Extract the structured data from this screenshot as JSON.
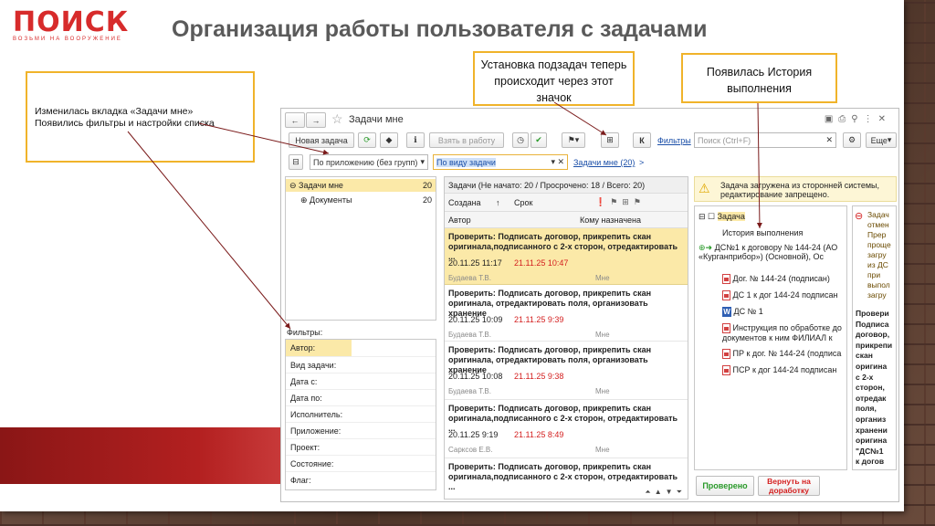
{
  "logo": {
    "text": "ПОИСК",
    "tagline": "ВОЗЬМИ НА ВООРУЖЕНИЕ"
  },
  "slide_title": "Организация работы пользователя с задачами",
  "callouts": {
    "c1_line1": "Изменилась вкладка «Задачи мне»",
    "c1_line2": "Появились фильтры и настройки списка",
    "c2": "Установка подзадач теперь происходит через этот значок",
    "c3": "Появилась История выполнения"
  },
  "window": {
    "title": "Задачи мне",
    "new_task": "Новая задача",
    "take_to_work": "Взять в работу",
    "k_label": "К",
    "filters_link": "Фильтры",
    "search_placeholder": "Поиск (Ctrl+F)",
    "more": "Еще",
    "grouping_value": "По приложению (без групп)",
    "task_type_value": "По виду задачи",
    "tasks_to_me_link": "Задачи мне (20)",
    "tasks_to_me_arrow": ">"
  },
  "tree": {
    "items": [
      {
        "label": "Задачи мне",
        "count": "20"
      },
      {
        "label": "Документы",
        "count": "20"
      }
    ]
  },
  "filters": {
    "title": "Фильтры:",
    "rows": [
      "Автор:",
      "Вид задачи:",
      "Дата с:",
      "Дата по:",
      "Исполнитель:",
      "Приложение:",
      "Проект:",
      "Состояние:",
      "Флаг:"
    ]
  },
  "list": {
    "header": "Задачи (Не начато: 20 / Просрочено: 18 / Всего: 20)",
    "col_created": "Создана",
    "col_due": "Срок",
    "col_author": "Автор",
    "col_assignee": "Кому назначена",
    "sort_arrow": "↑",
    "tasks": [
      {
        "title": "Проверить: Подписать договор, прикрепить скан оригинала,подписанного с 2-х сторон, отредактировать ...",
        "created": "20.11.25 11:17",
        "due": "21.11.25 10:47",
        "author": "Будаева Т.В.",
        "assignee": "Мне"
      },
      {
        "title": "Проверить: Подписать договор, прикрепить скан оригинала, отредактировать поля, организовать хранение",
        "created": "20.11.25 10:09",
        "due": "21.11.25 9:39",
        "author": "Будаева Т.В.",
        "assignee": "Мне"
      },
      {
        "title": "Проверить: Подписать договор, прикрепить скан оригинала, отредактировать поля, организовать хранение",
        "created": "20.11.25 10:08",
        "due": "21.11.25 9:38",
        "author": "Будаева Т.В.",
        "assignee": "Мне"
      },
      {
        "title": "Проверить: Подписать договор, прикрепить скан оригинала,подписанного с 2-х сторон, отредактировать ...",
        "created": "20.11.25 9:19",
        "due": "21.11.25 8:49",
        "author": "Сарксов Е.В.",
        "assignee": "Мне"
      },
      {
        "title": "Проверить: Подписать договор, прикрепить скан оригинала,подписанного с 2-х сторон, отредактировать ...",
        "created": "",
        "due": "",
        "author": "",
        "assignee": ""
      }
    ]
  },
  "detail": {
    "warning": "Задача загружена из сторонней системы, редактирование запрещено.",
    "tree_task": "Задача",
    "history": "История выполнения",
    "doc_main": "ДС№1 к договору № 144-24 (АО «Курганприбор») (Основной), Ос",
    "files": [
      {
        "type": "pdf",
        "label": "Дог. № 144-24 (подписан)"
      },
      {
        "type": "pdf",
        "label": "ДС 1 к дог 144-24 подписан"
      },
      {
        "type": "word",
        "label": "ДС № 1"
      },
      {
        "type": "pdf",
        "label": "Инструкция по обработке до документов к ним  ФИЛИАЛ к"
      },
      {
        "type": "pdf",
        "label": "ПР к дог. № 144-24 (подписа"
      },
      {
        "type": "pdf",
        "label": "ПСР к дог 144-24 подписан"
      }
    ],
    "side_note_lines": [
      "Задач",
      "отмен",
      "Прер",
      "проще",
      "загру",
      "из ДС",
      "при",
      "выпол",
      "загру"
    ],
    "side_task_lines": [
      "Провери",
      "Подписа",
      "договор,",
      "прикрепи",
      "скан",
      "оригина",
      "с 2-х",
      "сторон,",
      "отредак",
      "поля,",
      "организ",
      "хранени",
      "оригина",
      "\"ДС№1",
      "к догов"
    ],
    "approved": "Проверено",
    "return": "Вернуть на доработку"
  },
  "colors": {
    "accent_red": "#d72b2b",
    "callout_border": "#f0b32a",
    "selection": "#fbe9a8"
  }
}
